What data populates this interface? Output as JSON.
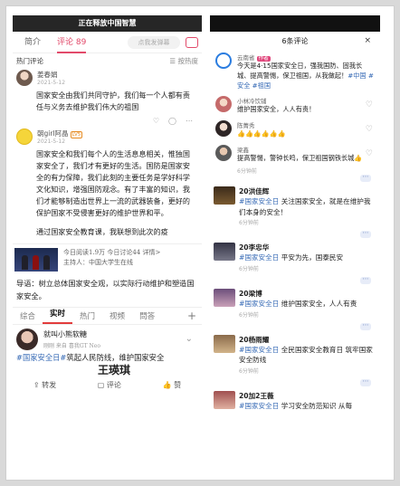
{
  "left": {
    "banner": "正在释放中国智慧",
    "tabs": [
      "简介",
      "评论 89"
    ],
    "comment_placeholder": "点我发弹幕",
    "section": {
      "title": "热门评论",
      "sort": "按热度"
    },
    "comments": [
      {
        "user": "姜春娟",
        "date": "2021-5-12",
        "text": "国家安全由我们共同守护，我们每一个人都有责任与义务去维护我们伟大的祖国"
      },
      {
        "user": "朝girl阿晶",
        "level": "LV5",
        "date": "2021-5-12",
        "text": "国家安全和我们每个人的生活息息相关，惟独国家安全了，我们才有更好的生活。国防是国家安全的有力保障，我们此刻的主要任务是学好科学文化知识，增强国防观念。有了丰富的知识，我们才能够制造出世界上一流的武器装备，更好的保护国家不受侵害更好的维护世界和平。",
        "extra": "通过国家安全教育课，我联想到此次的疫"
      }
    ],
    "news": {
      "meta1": "今日阅读1.9万  今日讨论44  详情>",
      "meta2": "主持人：中国大学生在线",
      "summary": "导语：树立总体国家安全观，以实际行动维护和塑造国家安全。"
    },
    "tabs2": [
      "综合",
      "实时",
      "热门",
      "视频",
      "問答"
    ],
    "weibo": {
      "user": "就叫小熊软糖",
      "sub": "刚刚 来自 喜我GT Neo",
      "tag": "#国家安全日#",
      "text": "筑起人民防线，维护国家安全",
      "signature": "王瑛琪",
      "actions": [
        "转发",
        "评论",
        "赞"
      ]
    }
  },
  "right": {
    "title": "6条评论",
    "close": "×",
    "comments": [
      {
        "user": "云南省",
        "badge": "作者",
        "text": "今天是4·15国家安全日，强我国防、固我长城、提高警惕，保卫祖国，从我做起！",
        "tags": "#中国 #安全 #祖国"
      },
      {
        "user": "小林冷饮铺",
        "text": "维护国家安全，人人有责！"
      },
      {
        "user": "陈菁秀",
        "text": "👍👍👍👍👍👍"
      },
      {
        "user": "梁鑫",
        "text": "提高警惕，警钟长鸣，保卫祖国钢铁长城👍",
        "time": "6分钟前"
      }
    ],
    "posts": [
      {
        "name": "20洪佳辉",
        "tag": "#国家安全日",
        "text": "关注国家安全，就是在维护我们本身的安全！",
        "time": "6分钟前"
      },
      {
        "name": "20李忠华",
        "tag": "#国家安全日",
        "text": "平安为先，国泰民安",
        "time": "6分钟前"
      },
      {
        "name": "20梁博",
        "tag": "#国家安全日",
        "text": "维护国家安全，人人有责",
        "time": "6分钟前"
      },
      {
        "name": "20杨雨耀",
        "tag": "#国家安全日",
        "text": "全民国家安全教育日 筑牢国家安全防线",
        "time": "6分钟前"
      },
      {
        "name": "20加2王薇",
        "tag": "#国家安全日",
        "text": "学习安全防范知识 从每"
      }
    ]
  }
}
